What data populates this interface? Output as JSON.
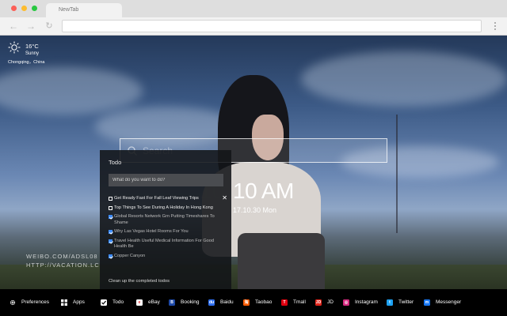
{
  "browser": {
    "tab_title": "NewTab",
    "url": ""
  },
  "weather": {
    "temperature": "16°C",
    "condition": "Sunny",
    "location": "Chongqing，China",
    "icon": "sun-icon"
  },
  "search": {
    "placeholder": "Search"
  },
  "clock": {
    "time": "10 AM",
    "date": "17.10.30 Mon",
    "shadow": "10"
  },
  "watermark": {
    "line1": "WEIBO.COM/ADSL08",
    "line2": "HTTP://VACATION.LC"
  },
  "todo": {
    "title": "Todo",
    "input_placeholder": "What do you want to do?",
    "items": [
      {
        "text": "Get Ready Fast For Fall Leaf Viewing Trips",
        "done": false
      },
      {
        "text": "Top Things To See During A Holiday In Hong Kong",
        "done": false
      },
      {
        "text": "Global Resorts Network Grn Putting Timeshares To Shame",
        "done": true
      },
      {
        "text": "Why Las Vegas Hotel Rooms For You",
        "done": true
      },
      {
        "text": "Travel Health Useful Medical Information For Good Health Be",
        "done": true
      },
      {
        "text": "Copper Canyon",
        "done": true
      }
    ],
    "delete_symbol": "✕",
    "clear_label": "Clean up the completed todos"
  },
  "bottom_bar": {
    "items": [
      {
        "label": "Preferences",
        "icon": "gear-icon",
        "color": "#000000"
      },
      {
        "label": "Apps",
        "icon": "grid-icon",
        "color": "#000000"
      },
      {
        "label": "Todo",
        "icon": "checkbox-icon",
        "color": "#ffffff"
      },
      {
        "label": "eBay",
        "icon": "ebay-icon",
        "color": "#ffffff"
      },
      {
        "label": "Booking",
        "icon": "booking-icon",
        "color": "#1f4aa8"
      },
      {
        "label": "Baidu",
        "icon": "baidu-icon",
        "color": "#2f6ff0"
      },
      {
        "label": "Taobao",
        "icon": "taobao-icon",
        "color": "#ff5a00"
      },
      {
        "label": "Tmall",
        "icon": "tmall-icon",
        "color": "#e0000f"
      },
      {
        "label": "JD",
        "icon": "jd-icon",
        "color": "#e1251b"
      },
      {
        "label": "Instagram",
        "icon": "instagram-icon",
        "color": "#d6297f"
      },
      {
        "label": "Twitter",
        "icon": "twitter-icon",
        "color": "#1da1f2"
      },
      {
        "label": "Messenger",
        "icon": "messenger-icon",
        "color": "#1877f2"
      }
    ]
  }
}
